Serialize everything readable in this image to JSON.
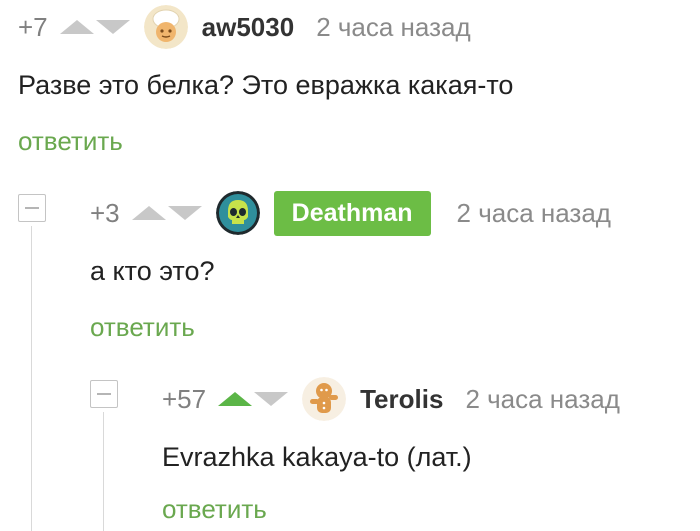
{
  "comments": [
    {
      "rating": "+7",
      "author": "aw5030",
      "time": "2 часа назад",
      "text": "Разве это белка? Это евражка какая-то",
      "reply": "ответить",
      "avatar_icon": "chef-avatar",
      "upvoted": false
    },
    {
      "rating": "+3",
      "author": "Deathman",
      "time": "2 часа назад",
      "text": "а кто это?",
      "reply": "ответить",
      "avatar_icon": "skull-avatar",
      "upvoted": false,
      "author_badge_color": "#6cbd45"
    },
    {
      "rating": "+57",
      "author": "Terolis",
      "time": "2 часа назад",
      "text": "Evrazhka kakaya-to (лат.)",
      "reply": "ответить",
      "avatar_icon": "gingerbread-avatar",
      "upvoted": true
    }
  ],
  "colors": {
    "accent_green": "#6aa84f",
    "upvote_active": "#5bb547",
    "muted": "#8a8a8a"
  }
}
